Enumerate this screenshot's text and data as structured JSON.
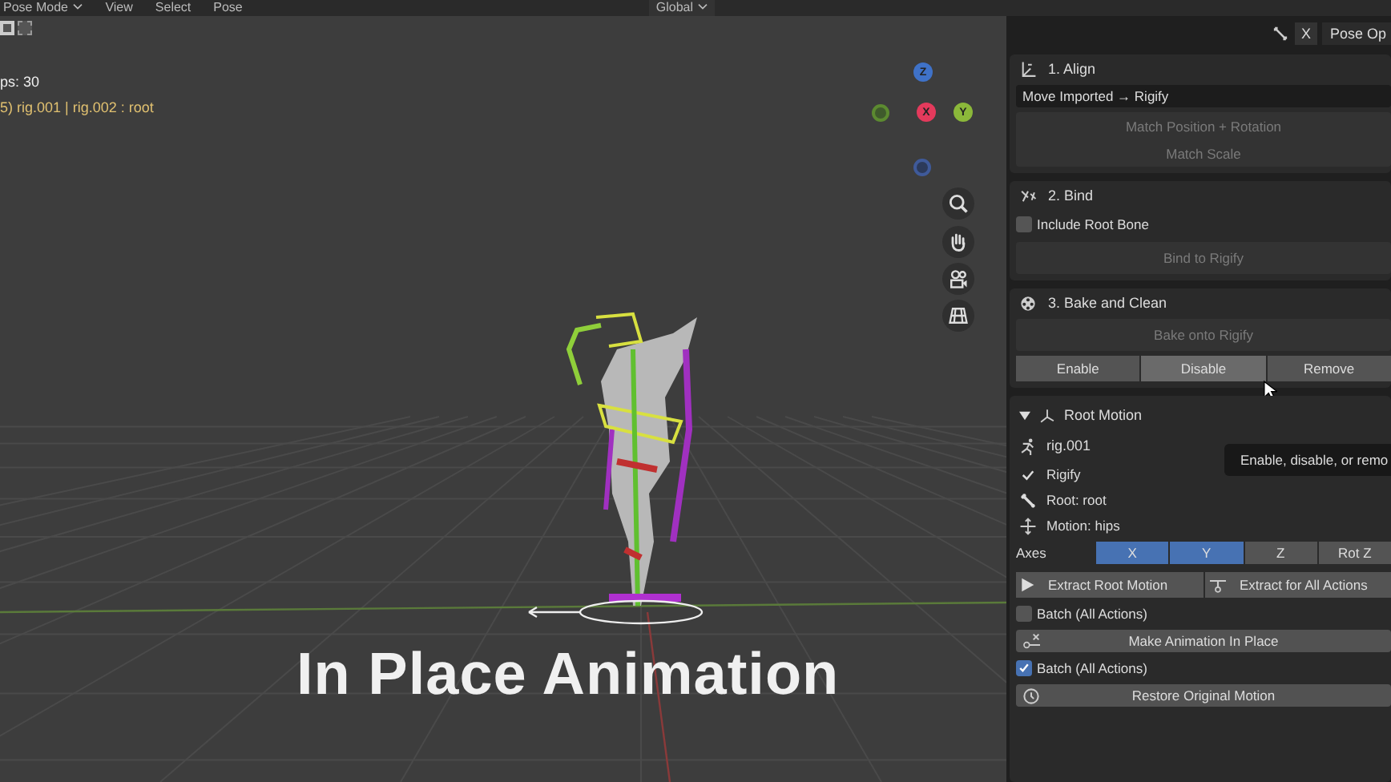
{
  "header": {
    "mode": "Pose Mode",
    "menus": [
      "View",
      "Select",
      "Pose"
    ],
    "orientation": "Global"
  },
  "viewport": {
    "stats": "ps: 30",
    "selection": "5) rig.001 | rig.002 : root",
    "gizmo": [
      "Z",
      "X",
      "Y"
    ],
    "caption": "In Place Animation"
  },
  "panel_tabs": {
    "close": "X",
    "tab": "Pose Op"
  },
  "align": {
    "title": "1. Align",
    "dropdown": "Move Imported → Rigify",
    "buttons": [
      {
        "label": "Match Position + Rotation",
        "disabled": true
      },
      {
        "label": "Match Scale",
        "disabled": true
      }
    ]
  },
  "bind": {
    "title": "2. Bind",
    "checkbox": {
      "label": "Include Root Bone",
      "checked": false
    },
    "button": {
      "label": "Bind to Rigify",
      "disabled": true
    }
  },
  "bake": {
    "title": "3. Bake and Clean",
    "button": {
      "label": "Bake onto Rigify",
      "disabled": true
    },
    "segments": [
      {
        "label": "Enable",
        "hovered": false
      },
      {
        "label": "Disable",
        "hovered": true
      },
      {
        "label": "Remove",
        "hovered": false
      }
    ],
    "tooltip": "Enable, disable, or remo"
  },
  "root_motion": {
    "title": "Root Motion",
    "expanded": true,
    "object": "rig.001",
    "info": [
      {
        "kind": "check",
        "text": "Rigify"
      },
      {
        "kind": "bone",
        "text": "Root: root"
      },
      {
        "kind": "move",
        "text": "Motion: hips"
      }
    ],
    "axes_label": "Axes",
    "axes": [
      {
        "label": "X",
        "selected": true
      },
      {
        "label": "Y",
        "selected": true
      },
      {
        "label": "Z",
        "selected": false
      },
      {
        "label": "Rot Z",
        "selected": false
      }
    ],
    "extract": [
      "Extract Root Motion",
      "Extract for All Actions"
    ],
    "batch_1": {
      "label": "Batch (All Actions)",
      "checked": false
    },
    "make_button": "Make Animation In Place",
    "batch_2": {
      "label": "Batch (All Actions)",
      "checked": true
    },
    "restore_button": "Restore Original Motion"
  }
}
